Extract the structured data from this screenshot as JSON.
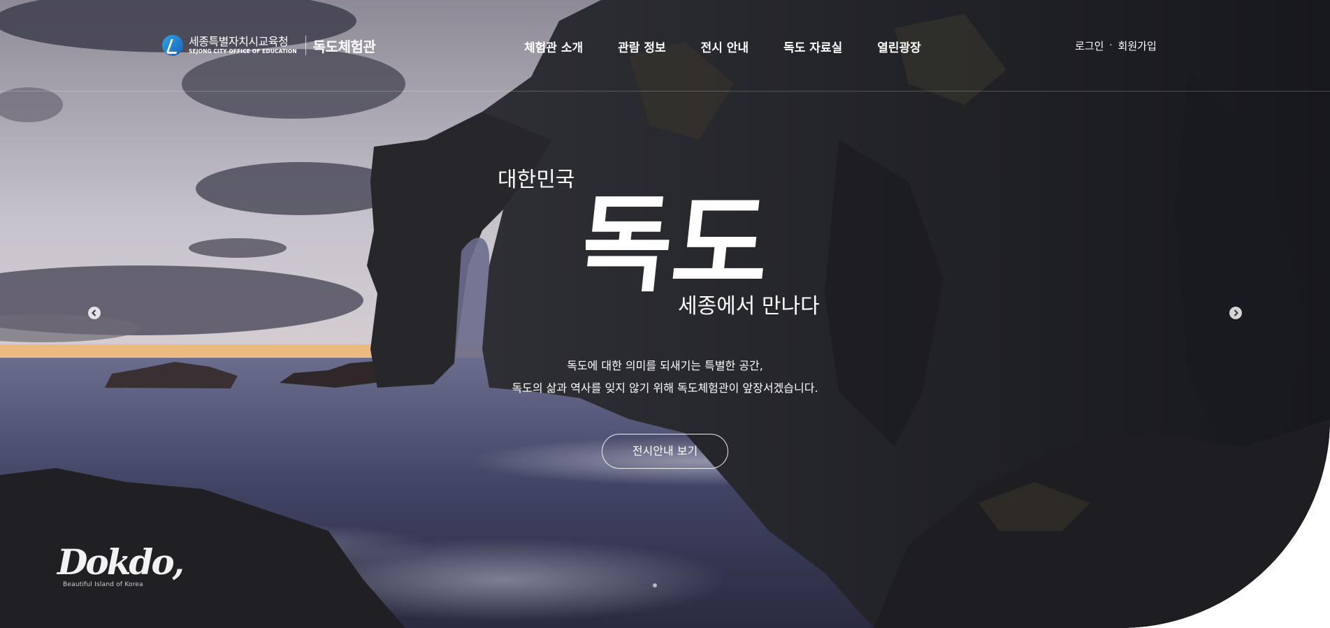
{
  "header": {
    "org_name": "세종특별자치시교육청",
    "org_name_en": "SEJONG CITY OFFICE OF EDUCATION",
    "site_name": "독도체험관",
    "nav": [
      {
        "label": "체험관 소개"
      },
      {
        "label": "관람 정보"
      },
      {
        "label": "전시 안내"
      },
      {
        "label": "독도 자료실"
      },
      {
        "label": "열린광장"
      }
    ],
    "util": {
      "login": "로그인",
      "separator": "·",
      "signup": "회원가입"
    }
  },
  "visual": {
    "line_top": "대한민국",
    "title": "독도",
    "line_bottom": "세종에서 만나다",
    "desc_line1": "독도에 대한 의미를 되새기는 특별한 공간,",
    "desc_line2": "독도의 삶과 역사를 잊지 않기 위해 독도체험관이 앞장서겠습니다.",
    "cta_label": "전시안내 보기"
  },
  "slider": {
    "prev_icon": "chevron-left-icon",
    "next_icon": "chevron-right-icon",
    "current_slide": 1,
    "total_slides": 1
  },
  "brand": {
    "word": "Dokdo,",
    "subtitle": "Beautiful Island of Korea"
  },
  "colors": {
    "sky": "#c9c4d0",
    "sunset": "#f3b36a",
    "sea": "#3a3f5c",
    "rock": "#1e1f24",
    "text": "#ffffff"
  }
}
